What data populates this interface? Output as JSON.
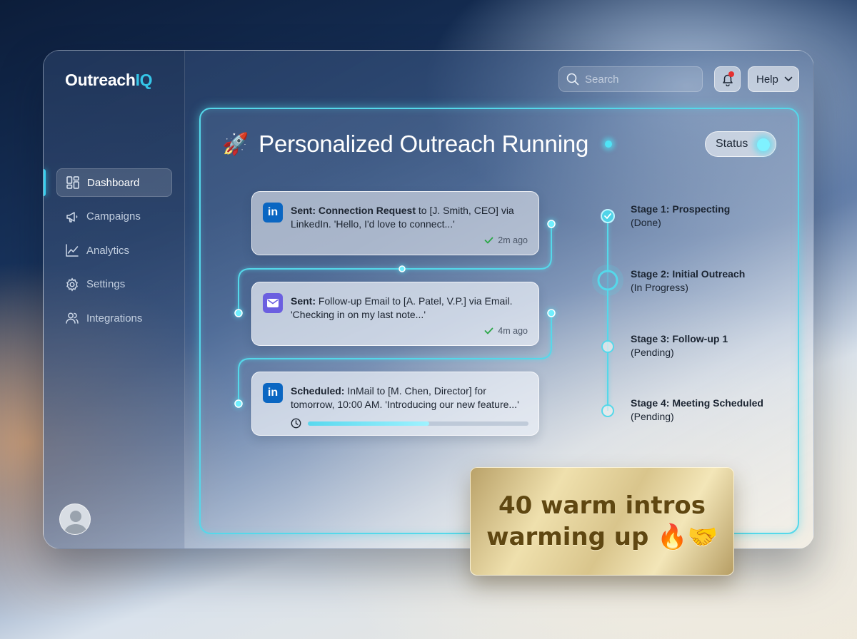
{
  "app": {
    "logo_main": "Outreach",
    "logo_accent": "IQ"
  },
  "sidebar": {
    "items": [
      {
        "label": "Dashboard",
        "icon": "dashboard-icon",
        "active": true
      },
      {
        "label": "Campaigns",
        "icon": "megaphone-icon",
        "active": false
      },
      {
        "label": "Analytics",
        "icon": "chart-line-icon",
        "active": false
      },
      {
        "label": "Settings",
        "icon": "gear-icon",
        "active": false
      },
      {
        "label": "Integrations",
        "icon": "users-icon",
        "active": false
      }
    ]
  },
  "header": {
    "search_placeholder": "Search",
    "help_label": "Help",
    "notification_unread": true
  },
  "panel": {
    "title": "Personalized Outreach Running",
    "title_emoji": "🚀",
    "status_label": "Status",
    "accent_color": "#55d8ea"
  },
  "activity": [
    {
      "channel": "LinkedIn",
      "badge": "in",
      "prefix": "Sent: Connection Request",
      "text": " to [J. Smith, CEO] via LinkedIn. 'Hello, I'd love to connect...'",
      "time": "2m ago"
    },
    {
      "channel": "Email",
      "badge": "mail",
      "prefix": "Sent:",
      "text": " Follow-up Email to [A. Patel, V.P.] via Email. 'Checking in on my last note...'",
      "time": "4m ago"
    },
    {
      "channel": "LinkedIn",
      "badge": "in",
      "prefix": "Scheduled:",
      "text": " InMail to [M. Chen, Director] for tomorrow, 10:00 AM. 'Introducing our new feature...'",
      "progress": 0.55
    }
  ],
  "stages": [
    {
      "name": "Stage 1: Prospecting",
      "status": "(Done)",
      "state": "done"
    },
    {
      "name": "Stage 2: Initial Outreach",
      "status": "(In Progress)",
      "state": "active"
    },
    {
      "name": "Stage 3: Follow-up 1",
      "status": "(Pending)",
      "state": "pending"
    },
    {
      "name": "Stage 4: Meeting Scheduled",
      "status": "(Pending)",
      "state": "pending"
    }
  ],
  "promo": {
    "line1": "40 warm intros",
    "line2": "warming up 🔥🤝"
  }
}
